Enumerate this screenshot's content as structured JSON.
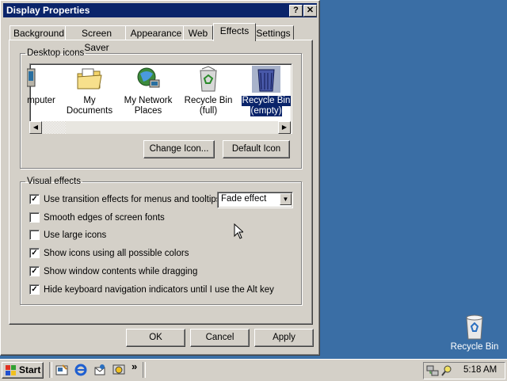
{
  "window": {
    "title": "Display Properties",
    "help_btn": "?",
    "close_btn": "✕"
  },
  "tabs": [
    "Background",
    "Screen Saver",
    "Appearance",
    "Web",
    "Effects",
    "Settings"
  ],
  "desktop_icons": {
    "legend": "Desktop icons",
    "items": [
      {
        "label": "mputer",
        "label2": "",
        "icon": "my-computer-icon"
      },
      {
        "label": "My Documents",
        "label2": "",
        "icon": "folder-icon"
      },
      {
        "label": "My Network",
        "label2": "Places",
        "icon": "network-places-icon"
      },
      {
        "label": "Recycle Bin",
        "label2": "(full)",
        "icon": "recycle-bin-full-icon"
      },
      {
        "label": "Recycle Bin",
        "label2": "(empty)",
        "icon": "recycle-bin-empty-icon"
      }
    ],
    "change_icon": "Change Icon...",
    "default_icon": "Default Icon"
  },
  "visual_effects": {
    "legend": "Visual effects",
    "options": [
      {
        "label": "Use transition effects for menus and tooltips",
        "checked": true
      },
      {
        "label": "Smooth edges of screen fonts",
        "checked": false
      },
      {
        "label": "Use large icons",
        "checked": false
      },
      {
        "label": "Show icons using all possible colors",
        "checked": true
      },
      {
        "label": "Show window contents while dragging",
        "checked": true
      },
      {
        "label": "Hide keyboard navigation indicators until I use the Alt key",
        "checked": true
      }
    ],
    "transition_select": "Fade effect"
  },
  "dialog_buttons": {
    "ok": "OK",
    "cancel": "Cancel",
    "apply": "Apply"
  },
  "taskbar": {
    "start": "Start",
    "chevron": "»",
    "clock": "5:18 AM"
  },
  "desktop": {
    "recycle_bin": "Recycle Bin"
  },
  "colors": {
    "desktop": "#3a6ea5",
    "titlebar": "#0a246a",
    "face": "#d4d0c8"
  }
}
